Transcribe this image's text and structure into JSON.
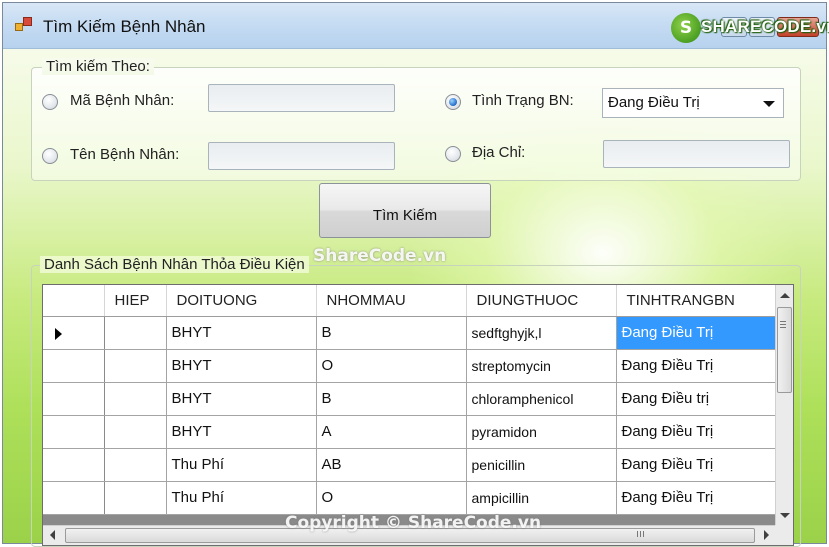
{
  "window": {
    "title": "Tìm Kiếm Bệnh Nhân",
    "brand_badge": "S",
    "brand_text": "SHARECODE.vn"
  },
  "search": {
    "legend": "Tìm kiếm Theo:",
    "patient_id_label": "Mã Bệnh Nhân:",
    "patient_id_value": "",
    "patient_name_label": "Tên Bệnh Nhân:",
    "patient_name_value": "",
    "status_label": "Tình Trạng BN:",
    "status_selected": "Đang Điều Trị",
    "address_label": "Địa Chỉ:",
    "address_value": "",
    "button_label": "Tìm Kiếm"
  },
  "watermarks": {
    "center": "ShareCode.vn",
    "bottom": "Copyright © ShareCode.vn"
  },
  "results": {
    "legend": "Danh Sách Bệnh Nhân Thỏa Điều Kiện",
    "columns": [
      "HIEP",
      "DOITUONG",
      "NHOMMAU",
      "DIUNGTHUOC",
      "TINHTRANGBN"
    ],
    "rows": [
      [
        "",
        "BHYT",
        "B",
        "sedftghyjk,l",
        "Đang Điều Trị"
      ],
      [
        "",
        "BHYT",
        "O",
        "streptomycin",
        "Đang Điều Trị"
      ],
      [
        "",
        "BHYT",
        "B",
        "chloramphenicol",
        "Đang Điều trị"
      ],
      [
        "",
        "BHYT",
        "A",
        "pyramidon",
        "Đang Điều Trị"
      ],
      [
        "",
        "Thu Phí",
        "AB",
        "penicillin",
        "Đang Điều Trị"
      ],
      [
        "",
        "Thu Phí",
        "O",
        "ampicillin",
        "Đang Điều Trị"
      ]
    ],
    "selected_row": 0,
    "selected_column": 4,
    "scrollbar_grip": "III"
  }
}
